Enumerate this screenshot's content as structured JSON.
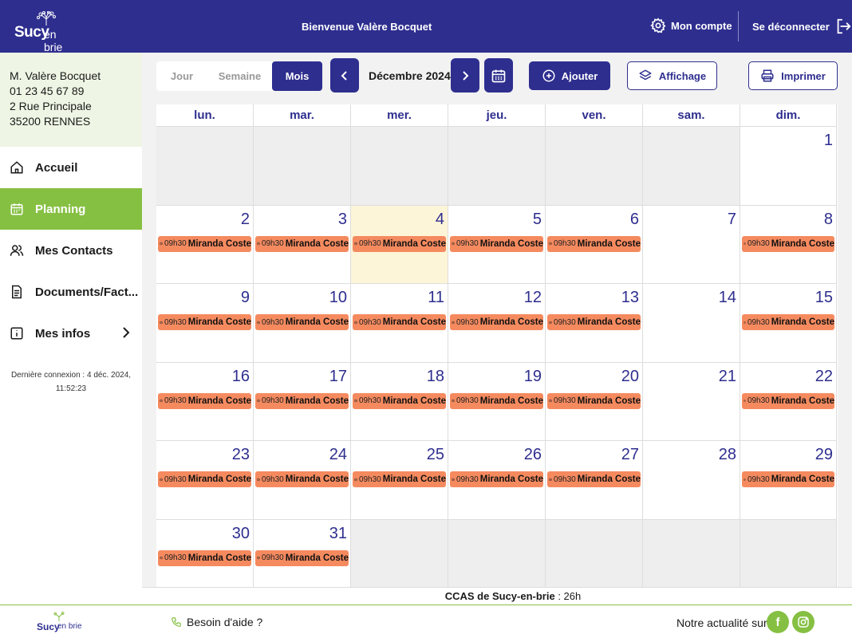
{
  "header": {
    "logo_main": "Sucy",
    "logo_sub": "en brie",
    "welcome": "Bienvenue Valère Bocquet",
    "account_label": "Mon compte",
    "logout_label": "Se déconnecter"
  },
  "user": {
    "name": "M. Valère Bocquet",
    "phone": "01 23 45 67 89",
    "address": "2 Rue Principale",
    "city": "35200 RENNES"
  },
  "nav": {
    "items": [
      {
        "label": "Accueil",
        "icon": "home-icon"
      },
      {
        "label": "Planning",
        "icon": "calendar-icon",
        "active": true
      },
      {
        "label": "Mes Contacts",
        "icon": "contacts-icon"
      },
      {
        "label": "Documents/Fact...",
        "icon": "document-icon"
      },
      {
        "label": "Mes infos",
        "icon": "info-icon"
      }
    ]
  },
  "last_login": {
    "line1": "Dernière connexion : 4 déc. 2024,",
    "line2": "11:52:23"
  },
  "toolbar": {
    "tab_day": "Jour",
    "tab_week": "Semaine",
    "tab_month": "Mois",
    "month_label": "Décembre 2024",
    "add_label": "Ajouter",
    "display_label": "Affichage",
    "print_label": "Imprimer"
  },
  "calendar": {
    "weekdays": [
      "lun.",
      "mar.",
      "mer.",
      "jeu.",
      "ven.",
      "sam.",
      "dim."
    ],
    "today": "4",
    "event_time": "09h30",
    "event_name": "Miranda Coste",
    "weeks": [
      [
        {
          "d": ""
        },
        {
          "d": ""
        },
        {
          "d": ""
        },
        {
          "d": ""
        },
        {
          "d": ""
        },
        {
          "d": ""
        },
        {
          "d": "1"
        }
      ],
      [
        {
          "d": "2",
          "e": true
        },
        {
          "d": "3",
          "e": true
        },
        {
          "d": "4",
          "e": true
        },
        {
          "d": "5",
          "e": true
        },
        {
          "d": "6",
          "e": true
        },
        {
          "d": "7"
        },
        {
          "d": "8",
          "e": true
        }
      ],
      [
        {
          "d": "9",
          "e": true
        },
        {
          "d": "10",
          "e": true
        },
        {
          "d": "11",
          "e": true
        },
        {
          "d": "12",
          "e": true
        },
        {
          "d": "13",
          "e": true
        },
        {
          "d": "14"
        },
        {
          "d": "15",
          "e": true
        }
      ],
      [
        {
          "d": "16",
          "e": true
        },
        {
          "d": "17",
          "e": true
        },
        {
          "d": "18",
          "e": true
        },
        {
          "d": "19",
          "e": true
        },
        {
          "d": "20",
          "e": true
        },
        {
          "d": "21"
        },
        {
          "d": "22",
          "e": true
        }
      ],
      [
        {
          "d": "23",
          "e": true
        },
        {
          "d": "24",
          "e": true
        },
        {
          "d": "25",
          "e": true
        },
        {
          "d": "26",
          "e": true
        },
        {
          "d": "27",
          "e": true
        },
        {
          "d": "28"
        },
        {
          "d": "29",
          "e": true
        }
      ],
      [
        {
          "d": "30",
          "e": true
        },
        {
          "d": "31",
          "e": true
        },
        {
          "d": ""
        },
        {
          "d": ""
        },
        {
          "d": ""
        },
        {
          "d": ""
        },
        {
          "d": ""
        }
      ]
    ]
  },
  "status_bar": {
    "org": "CCAS de Sucy-en-brie",
    "hours": " : 26h"
  },
  "footer": {
    "logo_main": "Sucy",
    "logo_sub": "en brie",
    "help_label": "Besoin d'aide ?",
    "news_label": "Notre actualité sur"
  },
  "colors": {
    "primary": "#2e2e8f",
    "accent_green": "#86c043",
    "event": "#f58a5f",
    "today": "#fdf5d8"
  }
}
